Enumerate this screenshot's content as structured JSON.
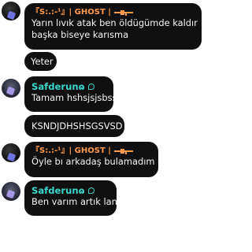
{
  "messages": [
    {
      "sender": "『S:.:-¹』| GHOST |",
      "text_lines": [
        "Yarın lıvık atak ben öldügümde kaldır",
        "başka biseye karısma"
      ]
    },
    {
      "text": "Yeter"
    },
    {
      "sender": "Safderunɷ",
      "text": "Tamam hshsjsjsbss"
    },
    {
      "text": "KSNDJDHSHSGSVSD"
    },
    {
      "sender": "『S:.:-¹』| GHOST |",
      "text": "Öyle bı arkadaş bulamadım"
    },
    {
      "sender": "Safderunɷ",
      "text": "Ben varım artık lan"
    }
  ],
  "icons": [
    "ghost-gun-icon",
    "safderun-badge-icon",
    "ghost-avatar",
    "safderun-avatar"
  ],
  "colors": {
    "ghost_name": "#ff9a4a",
    "safderun_name": "#3ad6c9",
    "bubble_bg": "#101010",
    "text": "#f4f4f4"
  }
}
